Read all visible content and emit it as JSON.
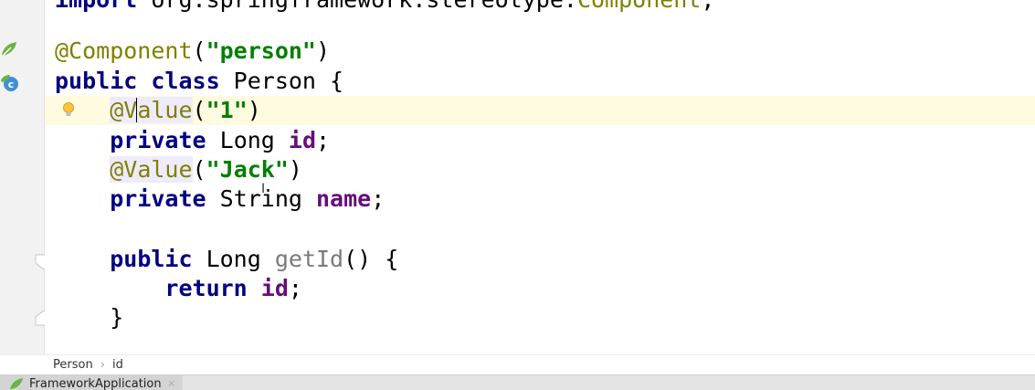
{
  "editor": {
    "lines": [
      {
        "id": "import",
        "parts": [
          {
            "t": "import ",
            "c": "kw"
          },
          {
            "t": "org.springframework.stereotype.",
            "c": ""
          },
          {
            "t": "Component",
            "c": "ann"
          },
          {
            "t": ";",
            "c": ""
          }
        ]
      },
      {
        "id": "blank1",
        "parts": []
      },
      {
        "id": "annotation-component",
        "parts": [
          {
            "t": "@Component",
            "c": "ann"
          },
          {
            "t": "(",
            "c": ""
          },
          {
            "t": "\"person\"",
            "c": "str"
          },
          {
            "t": ")",
            "c": ""
          }
        ]
      },
      {
        "id": "class-decl",
        "parts": [
          {
            "t": "public class ",
            "c": "kw"
          },
          {
            "t": "Person {",
            "c": ""
          }
        ]
      },
      {
        "id": "value-1",
        "parts": [
          {
            "t": "    ",
            "c": ""
          },
          {
            "t": "@V",
            "c": "ann ann-hl"
          },
          {
            "t": "",
            "c": "caret"
          },
          {
            "t": "alue",
            "c": "ann ann-hl"
          },
          {
            "t": "(",
            "c": ""
          },
          {
            "t": "\"1\"",
            "c": "str"
          },
          {
            "t": ")",
            "c": ""
          }
        ]
      },
      {
        "id": "field-id",
        "parts": [
          {
            "t": "    ",
            "c": ""
          },
          {
            "t": "private ",
            "c": "kw"
          },
          {
            "t": "Long ",
            "c": ""
          },
          {
            "t": "id",
            "c": "field"
          },
          {
            "t": ";",
            "c": ""
          }
        ]
      },
      {
        "id": "value-jack",
        "parts": [
          {
            "t": "    ",
            "c": ""
          },
          {
            "t": "@Value",
            "c": "ann ann-hl"
          },
          {
            "t": "(",
            "c": ""
          },
          {
            "t": "\"Jack\"",
            "c": "str"
          },
          {
            "t": ")",
            "c": ""
          }
        ]
      },
      {
        "id": "field-name",
        "parts": [
          {
            "t": "    ",
            "c": ""
          },
          {
            "t": "private ",
            "c": "kw"
          },
          {
            "t": "String ",
            "c": ""
          },
          {
            "t": "name",
            "c": "field"
          },
          {
            "t": ";",
            "c": ""
          }
        ]
      },
      {
        "id": "blank2",
        "parts": []
      },
      {
        "id": "method-getid",
        "parts": [
          {
            "t": "    ",
            "c": ""
          },
          {
            "t": "public ",
            "c": "kw"
          },
          {
            "t": "Long ",
            "c": ""
          },
          {
            "t": "getId",
            "c": "method"
          },
          {
            "t": "() {",
            "c": ""
          }
        ]
      },
      {
        "id": "return-id",
        "parts": [
          {
            "t": "        ",
            "c": ""
          },
          {
            "t": "return ",
            "c": "kw"
          },
          {
            "t": "id",
            "c": "field"
          },
          {
            "t": ";",
            "c": ""
          }
        ]
      },
      {
        "id": "close-brace",
        "parts": [
          {
            "t": "    }",
            "c": ""
          }
        ]
      }
    ],
    "current_line": "value-1"
  },
  "breadcrumbs": {
    "items": [
      "Person",
      "id"
    ],
    "separator": "›"
  },
  "run_panel": {
    "tab_label": "FrameworkApplication",
    "close_glyph": "×"
  },
  "icons": {
    "gutter_spring_bean": "spring-bean-icon",
    "gutter_class": "class-icon",
    "intention": "lightbulb-icon"
  },
  "colors": {
    "keyword": "#000080",
    "annotation": "#808000",
    "string": "#008000",
    "field": "#660e7a",
    "current_line": "#fffbe0"
  }
}
